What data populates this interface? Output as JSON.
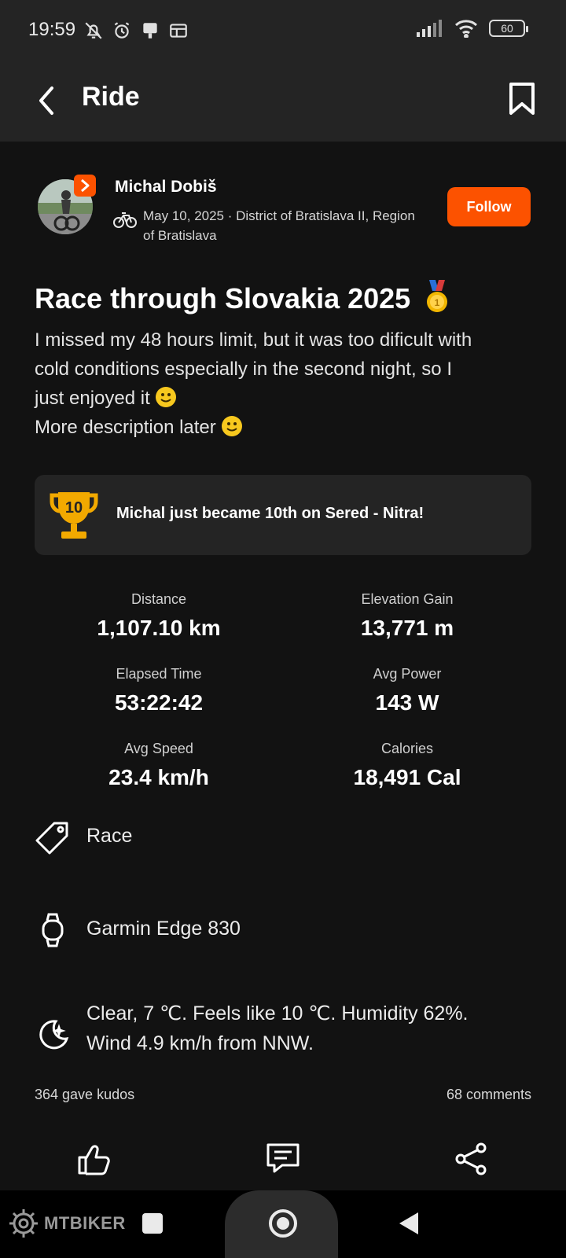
{
  "status_bar": {
    "time": "19:59",
    "battery": "60",
    "icons": [
      "mute-icon",
      "alarm-icon",
      "notification-icon",
      "window-icon",
      "signal-icon",
      "wifi-icon",
      "battery-icon"
    ]
  },
  "app_bar": {
    "title": "Ride",
    "back_icon": "chevron-left-icon",
    "bookmark_icon": "bookmark-icon"
  },
  "athlete": {
    "name": "Michal Dobiš",
    "meta": "May 10, 2025 · District of Bratislava II, Region of Bratislava",
    "follow_label": "Follow"
  },
  "activity": {
    "title": "Race through Slovakia 2025",
    "description_lines": [
      "I missed my 48 hours limit, but it was too dificult with",
      "cold conditions especially in the second night, so I",
      "just enjoyed it",
      "More description later"
    ]
  },
  "achievement": {
    "rank": "10",
    "text": "Michal just became 10th on Sered - Nitra!"
  },
  "stats": [
    {
      "label": "Distance",
      "value": "1,107.10 km"
    },
    {
      "label": "Elevation Gain",
      "value": "13,771 m"
    },
    {
      "label": "Elapsed Time",
      "value": "53:22:42"
    },
    {
      "label": "Avg Power",
      "value": "143 W"
    },
    {
      "label": "Avg Speed",
      "value": "23.4 km/h"
    },
    {
      "label": "Calories",
      "value": "18,491 Cal"
    }
  ],
  "details": {
    "workout_type": "Race",
    "device": "Garmin Edge 830",
    "weather_line1": "Clear, 7 ℃. Feels like 10 ℃. Humidity 62%.",
    "weather_line2": "Wind 4.9 km/h from NNW."
  },
  "social": {
    "kudos": "364 gave kudos",
    "comments": "68 comments"
  },
  "watermark": "MTBIKER",
  "colors": {
    "accent": "#fc5200",
    "background": "#121212",
    "bar": "#242424",
    "trophy": "#f2a900"
  }
}
